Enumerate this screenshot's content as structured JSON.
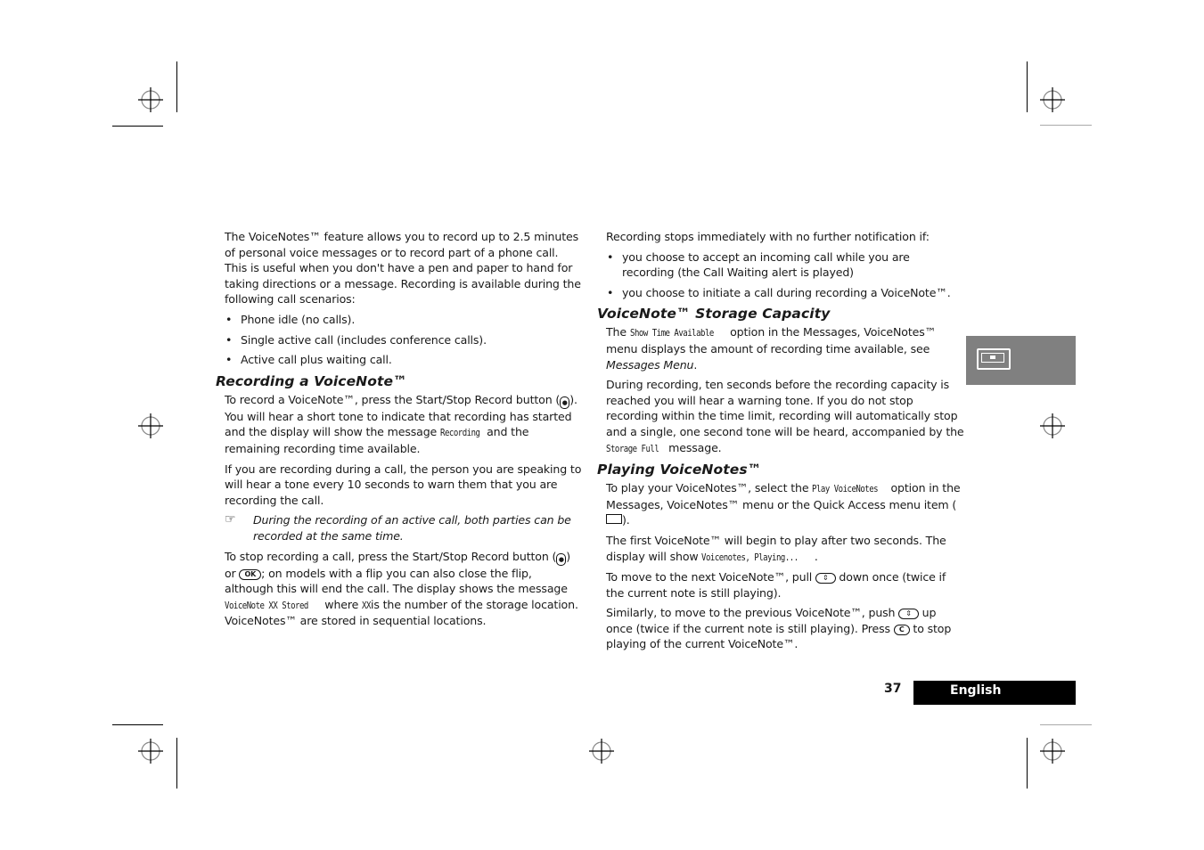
{
  "left_column": {
    "intro": "The VoiceNotes™ feature allows you to record up to 2.5 minutes of personal voice messages or to record part of a phone call. This is useful when you don't have a pen and paper to hand for taking directions or a message. Recording is available during the following call scenarios:",
    "scenarios": [
      "Phone idle (no calls).",
      "Single active call (includes conference calls).",
      "Active call plus waiting call."
    ],
    "recording_heading": "Recording a VoiceNote™",
    "rec_p1_a": "To record a VoiceNote™, press the Start/Stop Record button (",
    "rec_p1_b": "). You will hear a short tone to indicate that recording has started and the display will show the message ",
    "rec_p1_lcd": "Recording",
    "rec_p1_c": " and the remaining recording time available.",
    "rec_p2": "If you are recording during a call, the person you are speaking to will hear a tone every 10 seconds to warn them that you are recording the call.",
    "note_icon": "hand-pointing-icon",
    "note": "During the recording of an active call, both parties can be recorded at the same time.",
    "stop_a": "To stop recording a call, press the Start/Stop Record button (",
    "stop_b": ") or ",
    "ok_key": "OK",
    "stop_c": "; on models with a flip you can also close the flip, although this will end the call. The display shows the message ",
    "stop_lcd1": "VoiceNote XX Stored",
    "stop_d": " where ",
    "stop_lcd2": "XX",
    "stop_e": " is the number of the storage location. VoiceNotes™ are stored in sequential locations."
  },
  "right_column": {
    "stops_intro": "Recording stops immediately with no further notification if:",
    "stops_items": [
      "you choose to accept an incoming call while you are recording (the Call Waiting alert is played)",
      "you choose to initiate a call during recording a VoiceNote™."
    ],
    "storage_heading": "VoiceNote™ Storage Capacity",
    "storage_p1_a": "The ",
    "storage_p1_lcd": "Show Time Available",
    "storage_p1_b": " option in the Messages, VoiceNotes™ menu displays the amount of recording time available, see ",
    "storage_p1_link": "Messages Menu",
    "storage_p1_c": ".",
    "storage_p2_a": "During recording, ten seconds before the recording capacity is reached you will hear a warning tone. If you do not stop recording within the time limit, recording will automatically stop and a single, one second tone will be heard, accompanied by the ",
    "storage_p2_lcd": "Storage Full",
    "storage_p2_b": " message.",
    "playing_heading": "Playing VoiceNotes™",
    "play_p1_a": "To play your VoiceNotes™, select the ",
    "play_p1_lcd": "Play VoiceNotes",
    "play_p1_b": " option in the Messages, VoiceNotes™ menu or the Quick Access menu item  (",
    "play_p1_c": ").",
    "play_p2_a": "The first VoiceNote™ will begin to play after two seconds. The display will show ",
    "play_p2_lcd": "Voicenotes, Playing...",
    "play_p2_b": ".",
    "play_p3_a": "To move to the next VoiceNote™, pull ",
    "play_p3_b": " down once (twice if the current note is still playing).",
    "play_p4_a": "Similarly, to move to the previous VoiceNote™, push ",
    "play_p4_b": " up once (twice if the current note is still playing). Press ",
    "c_key": "C",
    "play_p4_c": " to stop playing of the current VoiceNote™."
  },
  "side_tab": {
    "icon": "cassette-icon",
    "color": "#808080"
  },
  "footer": {
    "page_number": "37",
    "language": "English"
  }
}
